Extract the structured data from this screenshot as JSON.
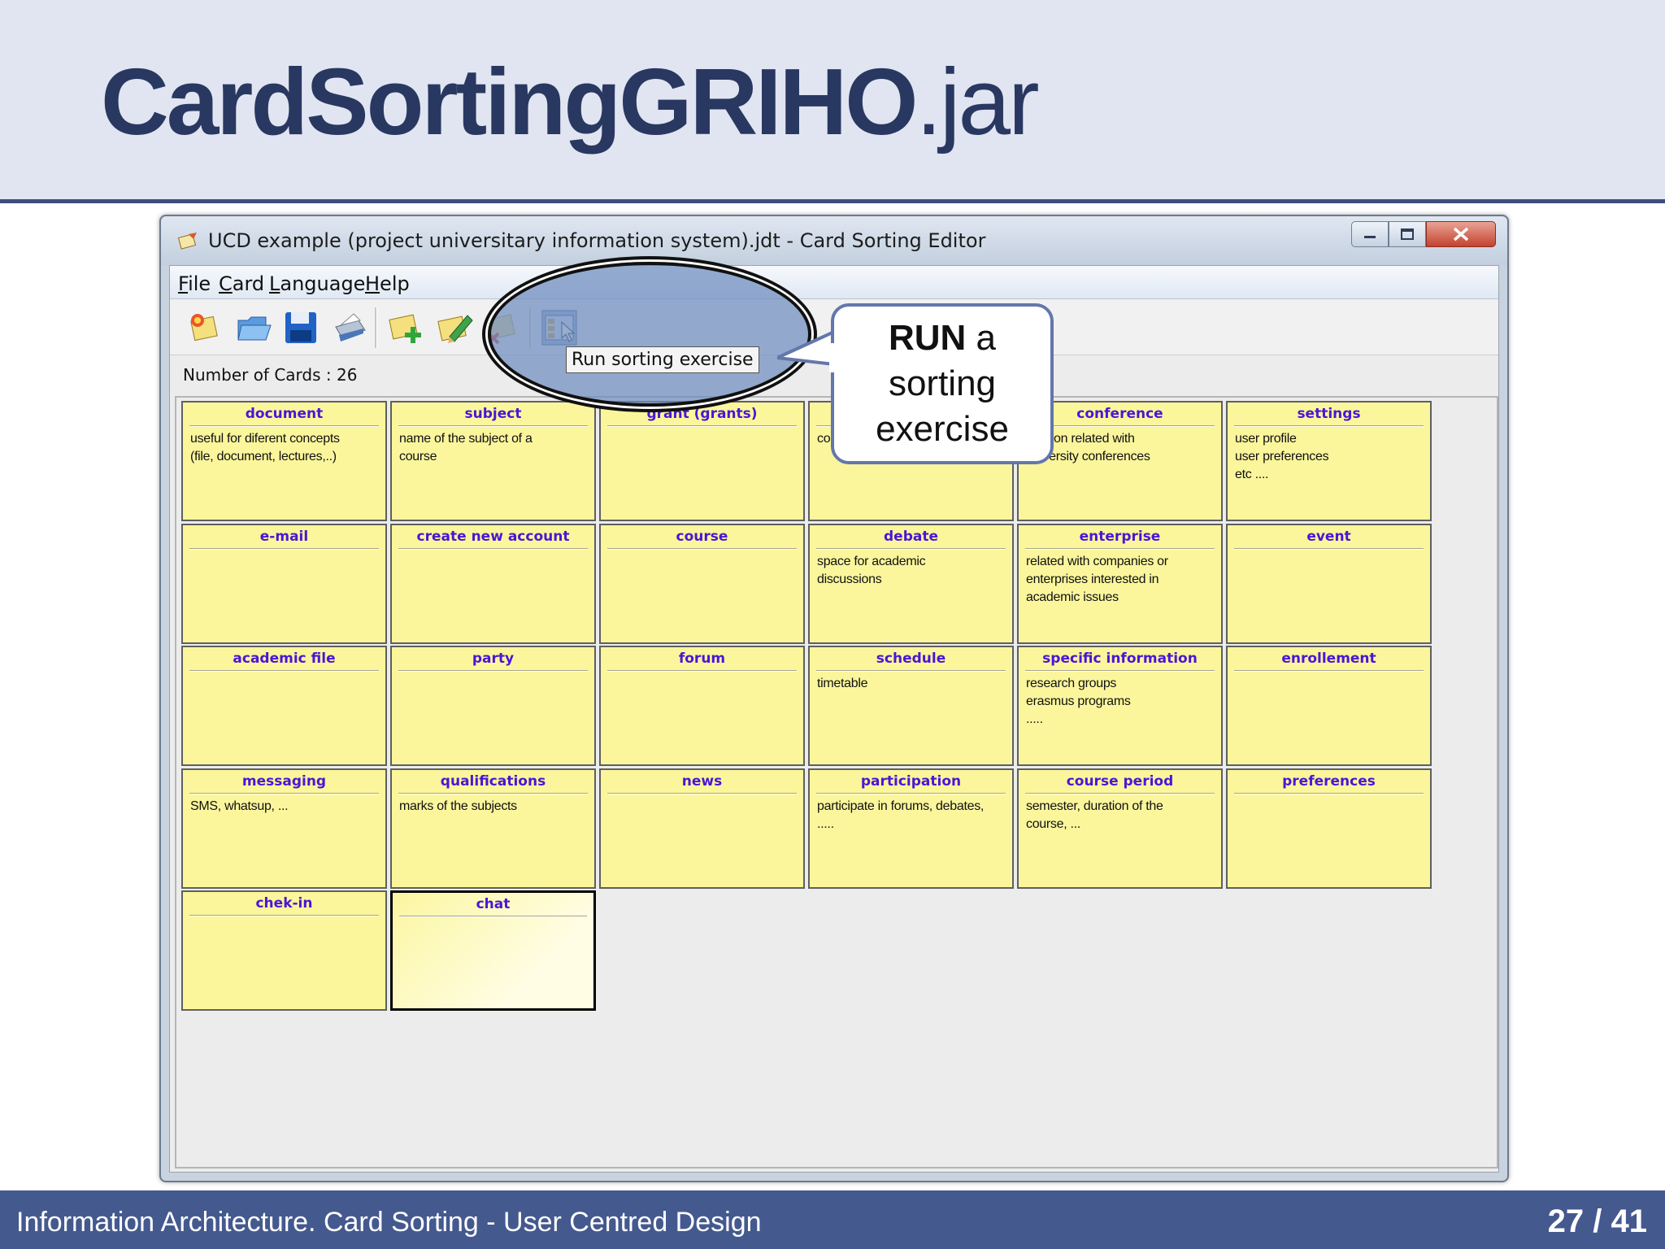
{
  "slide": {
    "title_bold": "CardSortingGRIHO",
    "title_normal": ".jar",
    "footer": "Information Architecture. Card Sorting - User Centred Design",
    "page": "27 / 41"
  },
  "window": {
    "title": "UCD example (project universitary information system).jdt - Card Sorting Editor",
    "menu": [
      "File",
      "Card",
      "Language",
      "Help"
    ],
    "toolbar_icons": [
      "new-project-icon",
      "open-folder-icon",
      "save-icon",
      "print-icon",
      "add-card-icon",
      "edit-card-icon",
      "delete-card-icon",
      "run-sorting-icon"
    ],
    "tooltip": "Run sorting exercise",
    "count_label": "Number of Cards : 26"
  },
  "callout": {
    "bold": "RUN",
    "rest1": " a",
    "rest2": "sorting",
    "rest3": "exercise"
  },
  "cards": [
    {
      "title": "document",
      "desc": "useful for diferent concepts\n(file, document, lectures,..)"
    },
    {
      "title": "subject",
      "desc": "name of the subject of a\ncourse"
    },
    {
      "title": "grant (grants)",
      "desc": ""
    },
    {
      "title": "",
      "desc": "co"
    },
    {
      "title": "conference",
      "desc": "rmation related with\nuniversity conferences"
    },
    {
      "title": "settings",
      "desc": "user profile\nuser preferences\netc ...."
    },
    {
      "title": "e-mail",
      "desc": ""
    },
    {
      "title": "create new account",
      "desc": ""
    },
    {
      "title": "course",
      "desc": ""
    },
    {
      "title": "debate",
      "desc": "space for academic\ndiscussions"
    },
    {
      "title": "enterprise",
      "desc": "related with companies or\nenterprises interested in\nacademic issues"
    },
    {
      "title": "event",
      "desc": ""
    },
    {
      "title": "academic file",
      "desc": ""
    },
    {
      "title": "party",
      "desc": ""
    },
    {
      "title": "forum",
      "desc": ""
    },
    {
      "title": "schedule",
      "desc": "timetable"
    },
    {
      "title": "specific information",
      "desc": "research groups\nerasmus programs\n....."
    },
    {
      "title": "enrollement",
      "desc": ""
    },
    {
      "title": "messaging",
      "desc": "SMS, whatsup, ..."
    },
    {
      "title": "qualifications",
      "desc": "marks of the subjects"
    },
    {
      "title": "news",
      "desc": ""
    },
    {
      "title": "participation",
      "desc": "participate in forums, debates,\n....."
    },
    {
      "title": "course period",
      "desc": "semester, duration of the\ncourse, ..."
    },
    {
      "title": "preferences",
      "desc": ""
    },
    {
      "title": "chek-in",
      "desc": ""
    },
    {
      "title": "chat",
      "desc": ""
    }
  ]
}
